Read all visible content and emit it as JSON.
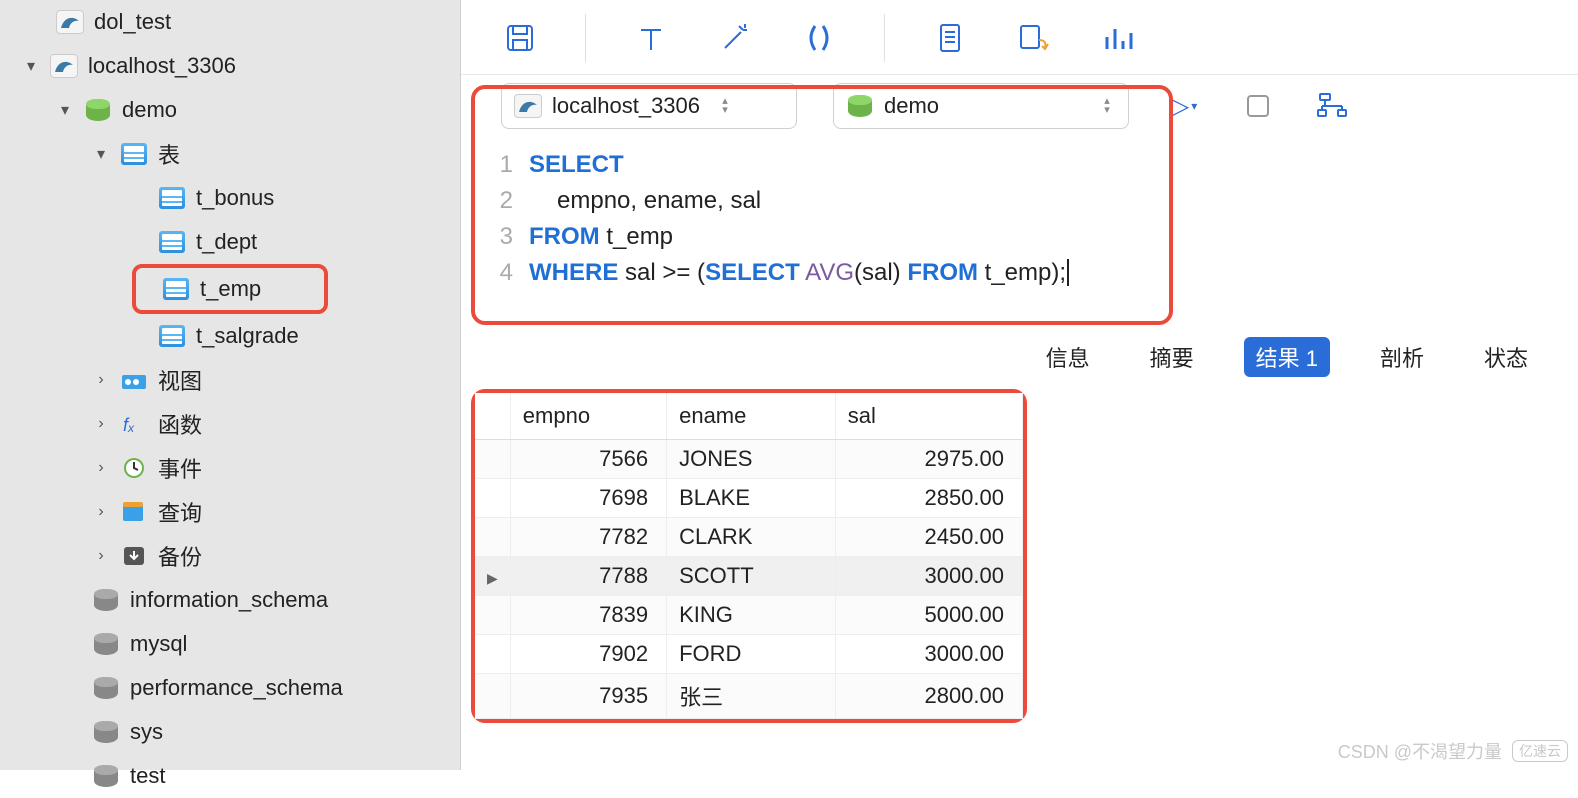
{
  "connection": {
    "name": "localhost_3306"
  },
  "database": {
    "name": "demo"
  },
  "sidebar": {
    "top_item": "dol_test",
    "connection_label": "localhost_3306",
    "db_label": "demo",
    "tables_label": "表",
    "tables": [
      "t_bonus",
      "t_dept",
      "t_emp",
      "t_salgrade"
    ],
    "selected_table_index": 2,
    "categories": {
      "views": "视图",
      "functions": "函数",
      "events": "事件",
      "queries": "查询",
      "backups": "备份"
    },
    "other_dbs": [
      "information_schema",
      "mysql",
      "performance_schema",
      "sys",
      "test"
    ]
  },
  "editor": {
    "lines": {
      "l1": {
        "ln": "1",
        "kw": "SELECT"
      },
      "l2": {
        "ln": "2",
        "body": "empno, ename, sal"
      },
      "l3": {
        "ln": "3",
        "kw": "FROM",
        "rest": " t_emp"
      },
      "l4": {
        "ln": "4",
        "kw1": "WHERE",
        "mid": " sal >= (",
        "kw2": "SELECT",
        "sp": " ",
        "fn": "AVG",
        "arg": "(sal) ",
        "kw3": "FROM",
        "rest": " t_emp);"
      }
    }
  },
  "result_tabs": {
    "info": "信息",
    "summary": "摘要",
    "result": "结果 1",
    "analyze": "剖析",
    "status": "状态"
  },
  "results": {
    "columns": [
      "empno",
      "ename",
      "sal"
    ],
    "current_row_index": 3,
    "rows": [
      {
        "empno": "7566",
        "ename": "JONES",
        "sal": "2975.00"
      },
      {
        "empno": "7698",
        "ename": "BLAKE",
        "sal": "2850.00"
      },
      {
        "empno": "7782",
        "ename": "CLARK",
        "sal": "2450.00"
      },
      {
        "empno": "7788",
        "ename": "SCOTT",
        "sal": "3000.00"
      },
      {
        "empno": "7839",
        "ename": "KING",
        "sal": "5000.00"
      },
      {
        "empno": "7902",
        "ename": "FORD",
        "sal": "3000.00"
      },
      {
        "empno": "7935",
        "ename": "张三",
        "sal": "2800.00"
      }
    ]
  },
  "watermark": {
    "text": "CSDN @不渴望力量",
    "brand": "亿速云"
  }
}
